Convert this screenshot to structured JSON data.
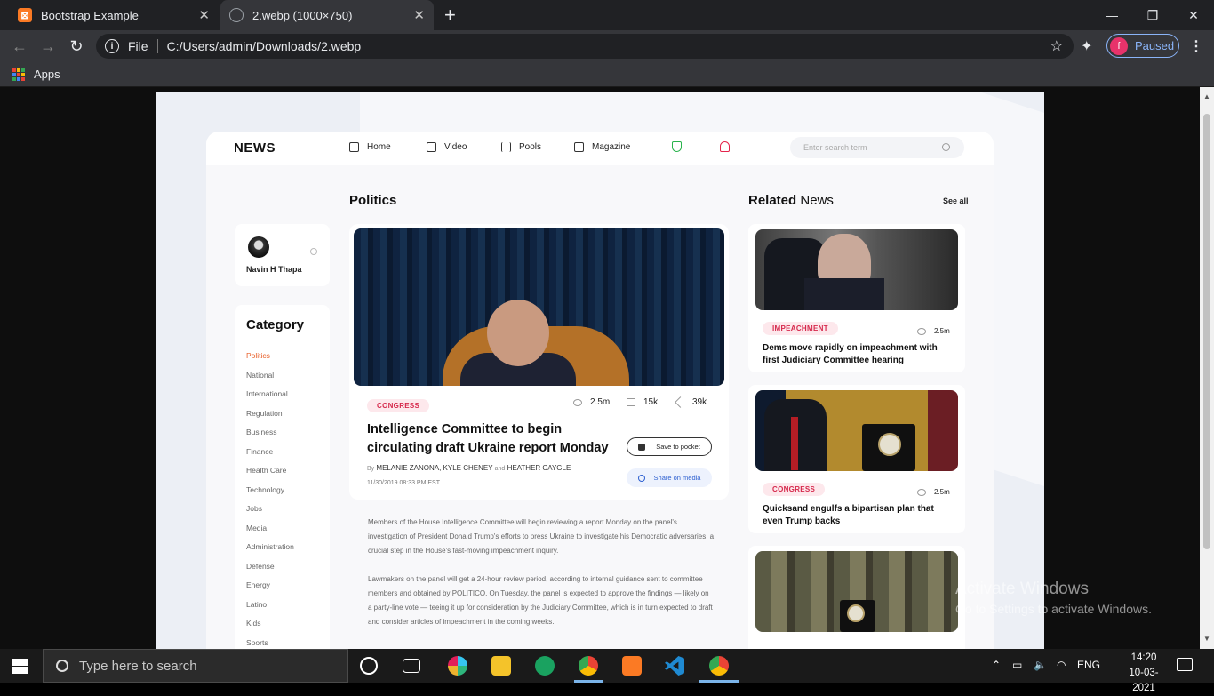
{
  "browser": {
    "tabs": [
      {
        "title": "Bootstrap Example"
      },
      {
        "title": "2.webp (1000×750)"
      }
    ],
    "address": {
      "scheme_label": "File",
      "url": "C:/Users/admin/Downloads/2.webp"
    },
    "profile": {
      "initial": "f",
      "status": "Paused"
    },
    "bookmarks": {
      "apps_label": "Apps"
    }
  },
  "site": {
    "logo": "NEWS",
    "nav": [
      "Home",
      "Video",
      "Pools",
      "Magazine"
    ],
    "search_placeholder": "Enter search term",
    "section_title": "Politics",
    "related_title_bold": "Related",
    "related_title_rest": " News",
    "see_all": "See all",
    "user": {
      "name": "Navin H Thapa"
    },
    "category": {
      "title": "Category",
      "items": [
        "Politics",
        "National",
        "International",
        "Regulation",
        "Business",
        "Finance",
        "Health Care",
        "Technology",
        "Jobs",
        "Media",
        "Administration",
        "Defense",
        "Energy",
        "Latino",
        "Kids",
        "Sports"
      ],
      "active": "Politics"
    },
    "article": {
      "tag": "CONGRESS",
      "views": "2.5m",
      "comments": "15k",
      "shares": "39k",
      "title": "Intelligence Committee to begin circulating draft Ukraine report Monday",
      "by_prefix": "By",
      "author1": "MELANIE ZANONA, KYLE CHENEY",
      "and": "and",
      "author2": "HEATHER CAYGLE",
      "date": "11/30/2019 08:33 PM EST",
      "save_label": "Save to pocket",
      "share_label": "Share on media",
      "paragraphs": [
        "Members of the House Intelligence Committee will begin reviewing a report Monday on the panel's investigation of President Donald Trump's efforts to press Ukraine to investigate his Democratic adversaries, a crucial step in the House's fast-moving impeachment inquiry.",
        "Lawmakers on the panel will get a 24-hour review period, according to internal guidance sent to committee members and obtained by POLITICO. On Tuesday, the panel is expected to approve the findings — likely on a party-line vote — teeing it up for consideration by the Judiciary Committee, which is in turn expected to draft and consider articles of impeachment in the coming weeks."
      ]
    },
    "related": [
      {
        "tag": "IMPEACHMENT",
        "views": "2.5m",
        "title": "Dems move rapidly on impeachment with first Judiciary Committee hearing"
      },
      {
        "tag": "CONGRESS",
        "views": "2.5m",
        "title": "Quicksand engulfs a bipartisan plan that even Trump backs"
      }
    ]
  },
  "watermark": {
    "line1": "Activate Windows",
    "line2": "Go to Settings to activate Windows."
  },
  "taskbar": {
    "search_placeholder": "Type here to search",
    "lang": "ENG",
    "time": "14:20",
    "date": "10-03-2021"
  }
}
